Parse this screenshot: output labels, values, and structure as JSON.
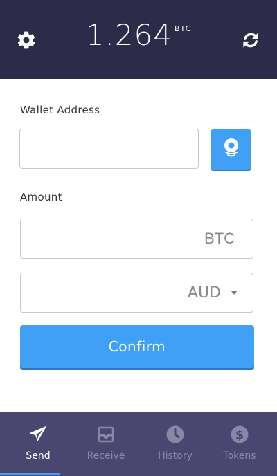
{
  "header": {
    "balance": "1.264",
    "unit": "BTC",
    "settings_icon": "gear-icon",
    "refresh_icon": "refresh-icon"
  },
  "form": {
    "wallet_label": "Wallet Address",
    "wallet_value": "",
    "qr_icon": "scan-icon",
    "amount_label": "Amount",
    "btc_placeholder": "BTC",
    "currency": "AUD",
    "confirm_label": "Confirm"
  },
  "nav": {
    "items": [
      {
        "label": "Send",
        "icon": "send-icon",
        "active": true
      },
      {
        "label": "Receive",
        "icon": "inbox-icon",
        "active": false
      },
      {
        "label": "History",
        "icon": "clock-icon",
        "active": false
      },
      {
        "label": "Tokens",
        "icon": "dollar-icon",
        "active": false
      }
    ]
  },
  "colors": {
    "header_bg": "#2d2b4a",
    "nav_bg": "#4a4670",
    "accent": "#3fa0f6",
    "inactive_nav": "#8a87a6"
  }
}
